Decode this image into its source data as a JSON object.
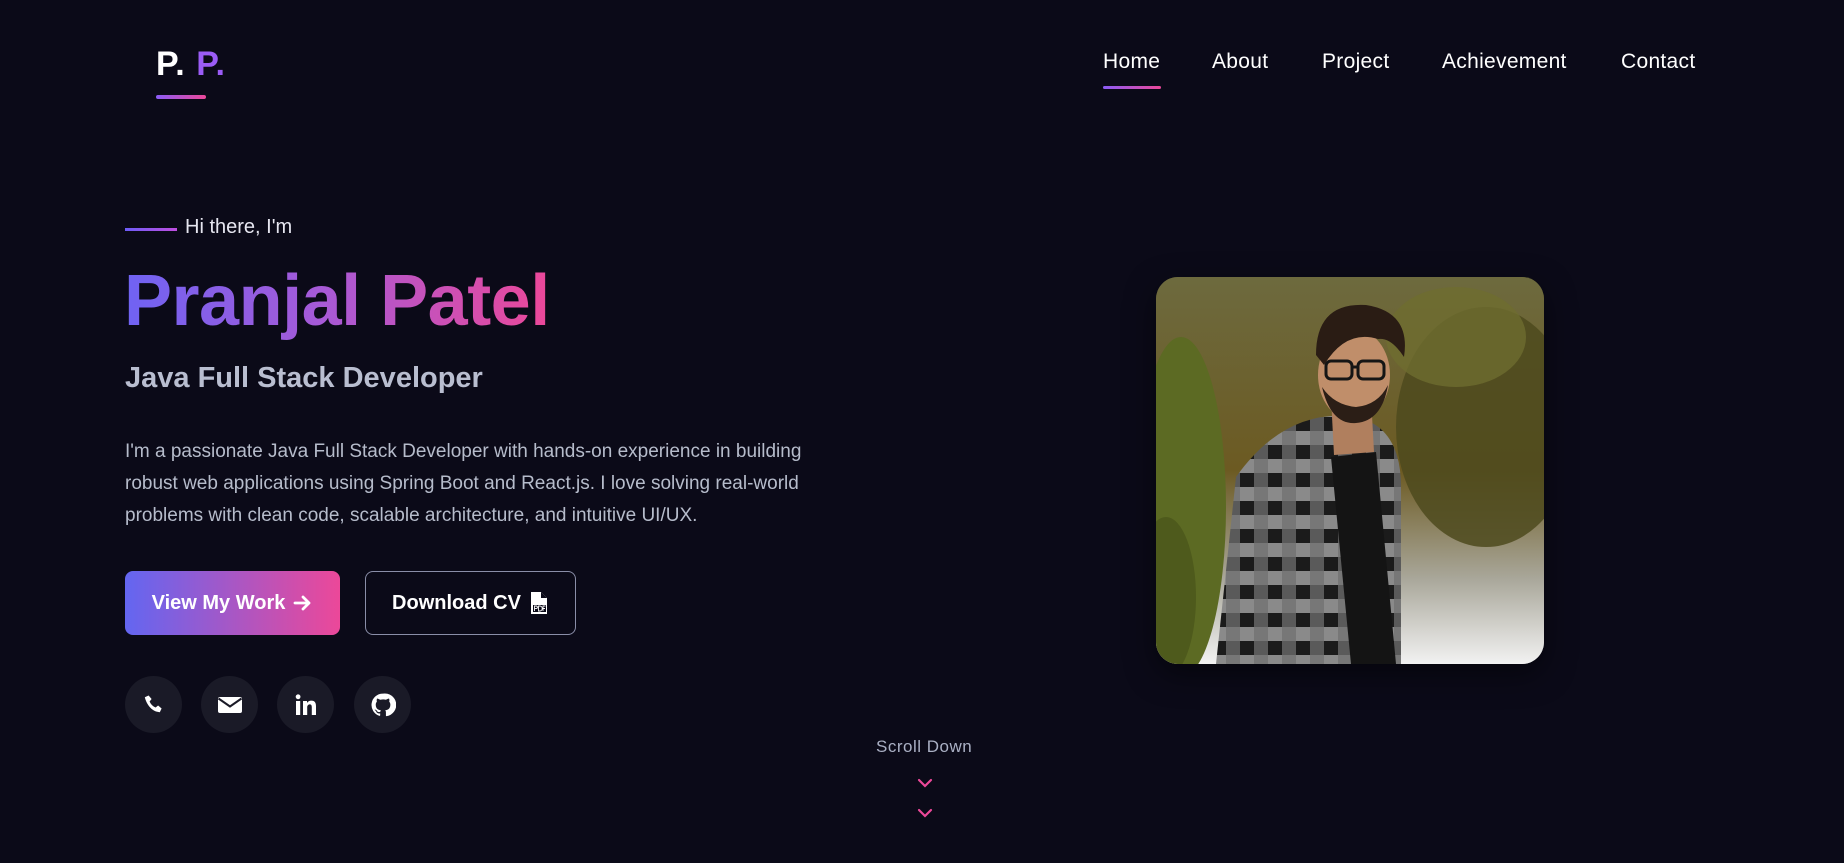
{
  "logo": {
    "part1": "P.",
    "part2": "P."
  },
  "nav": {
    "items": [
      {
        "label": "Home",
        "active": true
      },
      {
        "label": "About"
      },
      {
        "label": "Project"
      },
      {
        "label": "Achievement"
      },
      {
        "label": "Contact"
      }
    ]
  },
  "hero": {
    "greeting": "Hi there, I'm",
    "name": "Pranjal Patel",
    "role": "Java Full Stack Developer",
    "description": "I'm a passionate Java Full Stack Developer with hands-on experience in building robust web applications using Spring Boot and React.js. I love solving real-world problems with clean code, scalable architecture, and intuitive UI/UX.",
    "primary_button": "View My Work",
    "secondary_button": "Download CV",
    "scroll_label": "Scroll Down"
  },
  "socials": [
    {
      "icon": "phone-icon"
    },
    {
      "icon": "envelope-icon"
    },
    {
      "icon": "linkedin-icon"
    },
    {
      "icon": "github-icon"
    }
  ],
  "colors": {
    "background": "#0b0a18",
    "accent_start": "#6366f1",
    "accent_end": "#ec4899"
  }
}
